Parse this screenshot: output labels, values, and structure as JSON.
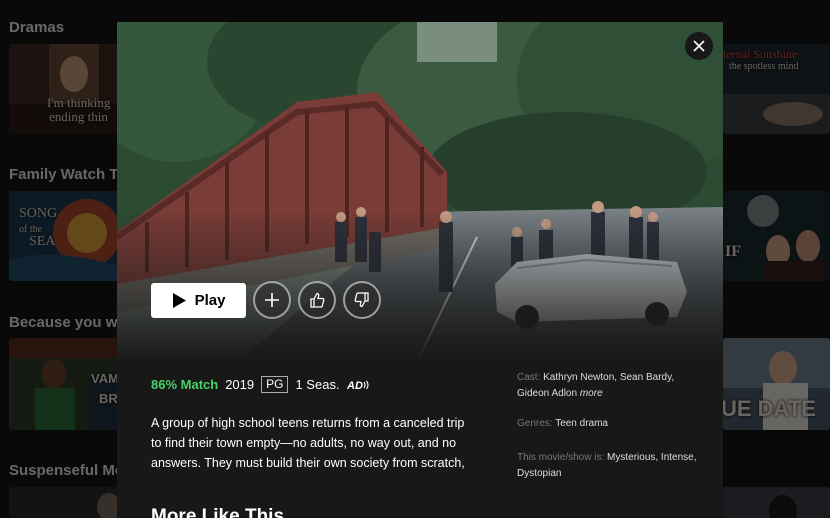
{
  "rows": [
    {
      "title": "Dramas"
    },
    {
      "title": "Family Watch Together TV"
    },
    {
      "title": "Because you watched"
    },
    {
      "title": "Suspenseful Movies"
    }
  ],
  "tiles": {
    "drama_left_caption_1": "I'm thinking",
    "drama_left_caption_2": "ending thin",
    "drama_right_caption_1": "ternal Sunshine",
    "drama_right_caption_2": "the spotless mind",
    "family_left_caption_1": "SONG",
    "family_left_caption_2": "of the",
    "family_left_caption_3": "SEA",
    "family_right_caption": "IF",
    "because_left_caption_1": "VAM",
    "because_left_caption_2": "BR",
    "because_right_caption": "UE DATE"
  },
  "modal": {
    "play_label": "Play",
    "meta": {
      "match": "86% Match",
      "year": "2019",
      "rating": "PG",
      "seasons": "1 Seas."
    },
    "synopsis": "A group of high school teens returns from a canceled trip to find their town empty—no adults, no way out, and no answers. They must build their own society from scratch,",
    "cast_label": "Cast:",
    "cast_value": "Kathryn Newton, Sean Bardy, Gideon Adlon",
    "cast_more": "more",
    "genres_label": "Genres:",
    "genres_value": "Teen drama",
    "mood_label": "This movie/show is:",
    "mood_value": "Mysterious, Intense, Dystopian",
    "more_like_title": "More Like This"
  },
  "colors": {
    "background": "#141414",
    "modal_background": "#181818",
    "match_green": "#46d369"
  },
  "icons": [
    "close-icon",
    "play-icon",
    "plus-icon",
    "thumbs-up-icon",
    "thumbs-down-icon",
    "audio-description-icon"
  ]
}
